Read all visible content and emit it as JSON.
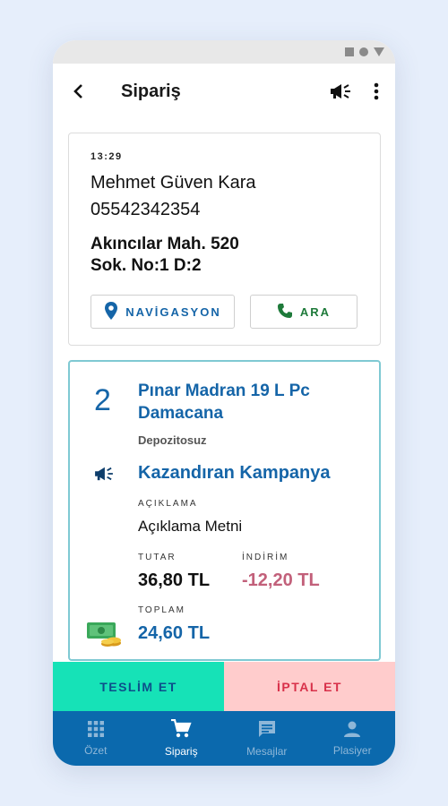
{
  "colors": {
    "primary": "#1565a8",
    "call_green": "#1e7a3a",
    "discount": "#c2607a",
    "deliver_bg": "#16e2b7",
    "cancel_bg": "#ffcccc",
    "nav_bg": "#0b69ad"
  },
  "appbar": {
    "title": "Sipariş",
    "icons": [
      "back-arrow-icon",
      "megaphone-icon",
      "more-vert-icon"
    ]
  },
  "customer": {
    "time": "13:29",
    "name": "Mehmet Güven Kara",
    "phone": "05542342354",
    "address_line1": "Akıncılar Mah. 520",
    "address_line2": "Sok. No:1 D:2",
    "nav_label": "NAVİGASYON",
    "call_label": "ARA"
  },
  "product": {
    "quantity": "2",
    "name": "Pınar Madran 19 L Pc Damacana",
    "subtitle": "Depozitosuz",
    "campaign": "Kazandıran Kampanya",
    "desc_label": "AÇIKLAMA",
    "desc": "Açıklama Metni",
    "tutar_label": "TUTAR",
    "tutar": "36,80 TL",
    "indirim_label": "İNDİRİM",
    "indirim": "-12,20 TL",
    "toplam_label": "TOPLAM",
    "toplam": "24,60 TL"
  },
  "actions": {
    "deliver": "TESLİM ET",
    "cancel": "İPTAL ET"
  },
  "nav": {
    "items": [
      {
        "label": "Özet",
        "icon": "grid-icon"
      },
      {
        "label": "Sipariş",
        "icon": "cart-icon",
        "active": true
      },
      {
        "label": "Mesajlar",
        "icon": "message-icon"
      },
      {
        "label": "Plasiyer",
        "icon": "person-icon"
      }
    ]
  }
}
